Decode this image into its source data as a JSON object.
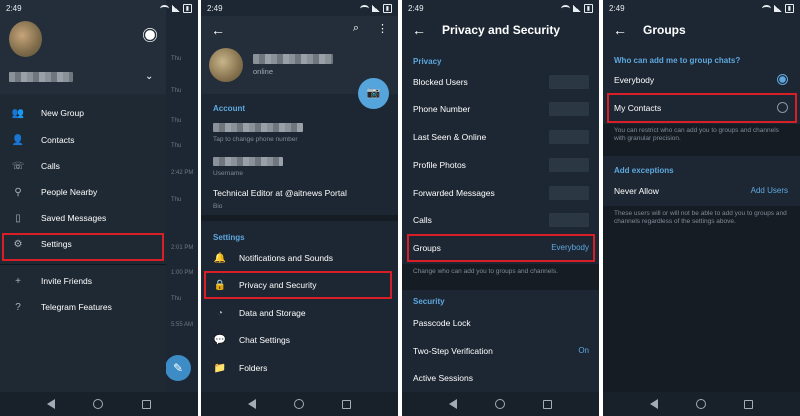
{
  "screens": [
    {
      "status_time": "2:49",
      "menu": [
        {
          "label": "New Group",
          "icon": "people-icon"
        },
        {
          "label": "Contacts",
          "icon": "person-icon"
        },
        {
          "label": "Calls",
          "icon": "phone-icon"
        },
        {
          "label": "People Nearby",
          "icon": "location-person-icon"
        },
        {
          "label": "Saved Messages",
          "icon": "bookmark-icon"
        },
        {
          "label": "Settings",
          "icon": "gear-icon"
        },
        {
          "label": "Invite Friends",
          "icon": "add-person-icon"
        },
        {
          "label": "Telegram Features",
          "icon": "question-icon"
        }
      ],
      "chat_times": [
        "Thu",
        "Thu",
        "Thu",
        "Thu",
        "2:42 PM",
        "Thu",
        "2:01 PM",
        "1:00 PM",
        "Thu",
        "5:55 AM"
      ]
    },
    {
      "status_time": "2:49",
      "online": "online",
      "account_header": "Account",
      "phone_hint": "Tap to change phone number",
      "username_label": "Username",
      "bio_text": "Technical Editor at @aitnews Portal",
      "bio_label": "Bio",
      "settings_header": "Settings",
      "settings_items": [
        {
          "label": "Notifications and Sounds",
          "icon": "bell-icon"
        },
        {
          "label": "Privacy and Security",
          "icon": "lock-icon"
        },
        {
          "label": "Data and Storage",
          "icon": "pie-chart-icon"
        },
        {
          "label": "Chat Settings",
          "icon": "chat-bubble-icon"
        },
        {
          "label": "Folders",
          "icon": "folder-icon"
        }
      ]
    },
    {
      "status_time": "2:49",
      "title": "Privacy and Security",
      "privacy_header": "Privacy",
      "rows": [
        "Blocked Users",
        "Phone Number",
        "Last Seen & Online",
        "Profile Photos",
        "Forwarded Messages",
        "Calls"
      ],
      "groups_label": "Groups",
      "groups_value": "Everybody",
      "groups_hint": "Change who can add you to groups and channels.",
      "security_header": "Security",
      "security_rows": [
        {
          "label": "Passcode Lock",
          "value": ""
        },
        {
          "label": "Two-Step Verification",
          "value": "On"
        },
        {
          "label": "Active Sessions",
          "value": ""
        }
      ]
    },
    {
      "status_time": "2:49",
      "title": "Groups",
      "question": "Who can add me to group chats?",
      "options": [
        {
          "label": "Everybody",
          "selected": true
        },
        {
          "label": "My Contacts",
          "selected": false
        }
      ],
      "restrict_hint": "You can restrict who can add you to groups and channels with granular precision.",
      "exceptions_header": "Add exceptions",
      "never_allow": "Never Allow",
      "add_users": "Add Users",
      "exceptions_hint": "These users will or will not be able to add you to groups and channels regardless of the settings above."
    }
  ]
}
